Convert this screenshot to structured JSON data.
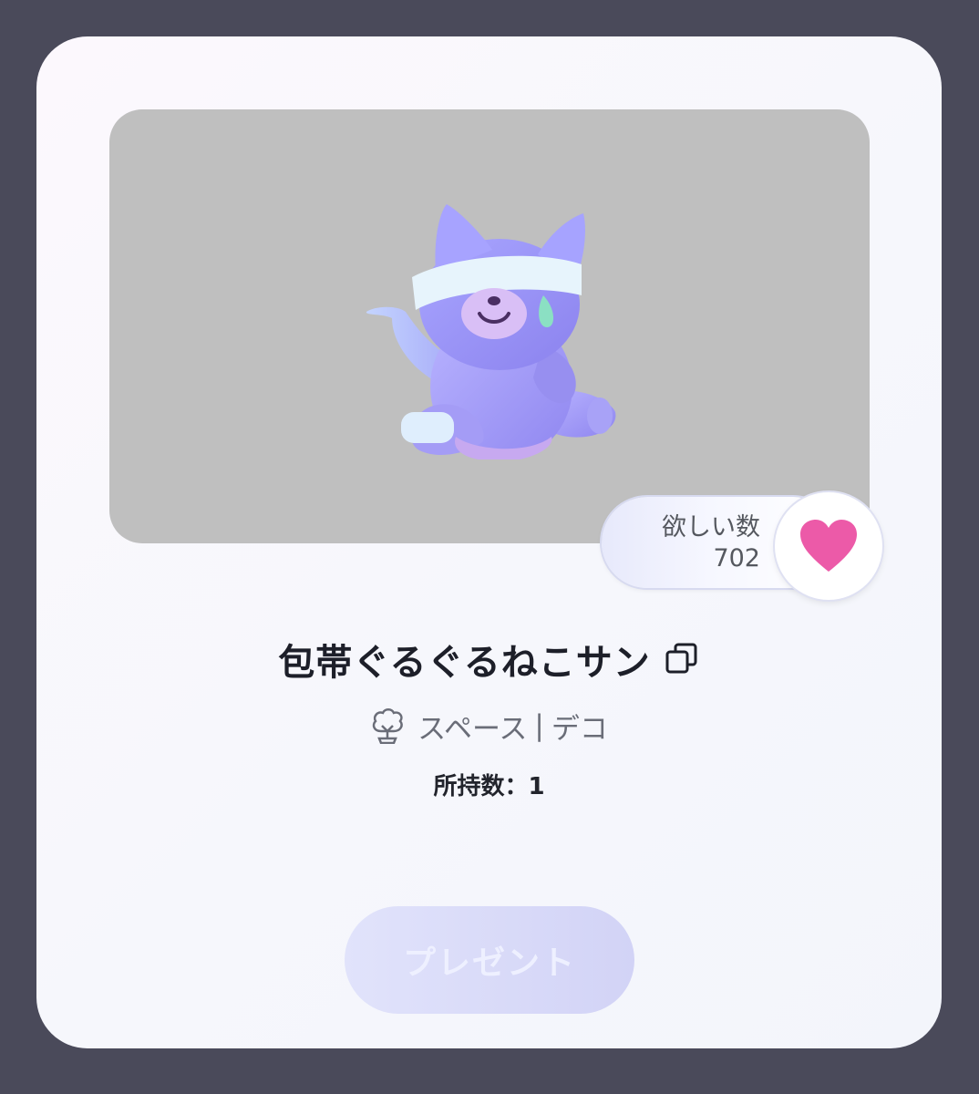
{
  "item": {
    "title": "包帯ぐるぐるねこサン",
    "category": "スペース",
    "separator": "|",
    "subcategory": "デコ",
    "owned_label": "所持数：1"
  },
  "wish": {
    "label": "欲しい数",
    "count": "702"
  },
  "actions": {
    "present_label": "プレゼント"
  },
  "colors": {
    "heart": "#ec5aa8",
    "present_button": "#d6d7f7",
    "preview_bg": "#bfbfbf"
  },
  "icons": {
    "copy": "copy-icon",
    "category": "tree-icon",
    "wish": "heart-icon"
  }
}
